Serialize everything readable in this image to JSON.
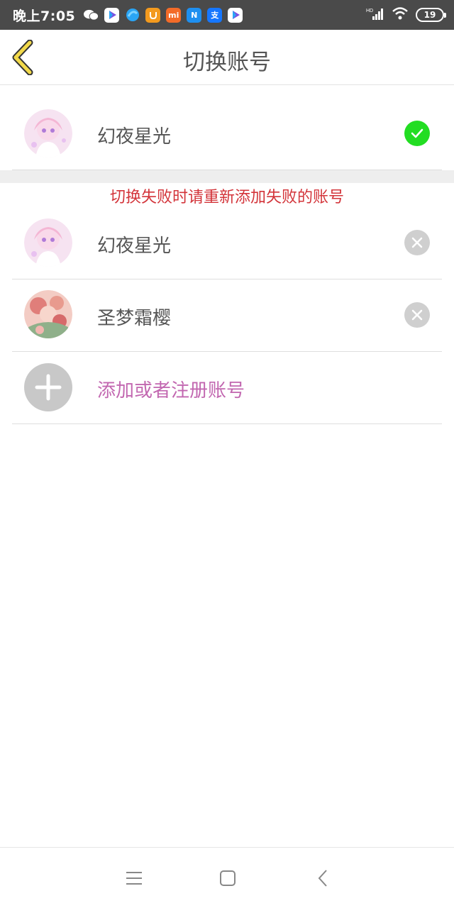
{
  "status_bar": {
    "time": "晚上7:05",
    "notification_icons": [
      "wechat-icon",
      "play-store-icon",
      "blue-app-icon",
      "orange-app-icon",
      "mi-icon",
      "n-app-icon",
      "alipay-icon",
      "play-store-icon"
    ],
    "mi_text": "mi",
    "n_text": "N",
    "alipay_text": "支",
    "battery": "19"
  },
  "header": {
    "title": "切换账号"
  },
  "current_account": {
    "name": "幻夜星光",
    "status": "check-icon"
  },
  "warning": "切换失败时请重新添加失败的账号",
  "accounts": [
    {
      "name": "幻夜星光",
      "action": "remove-icon"
    },
    {
      "name": "圣梦霜樱",
      "action": "remove-icon"
    }
  ],
  "add_account": {
    "label": "添加或者注册账号"
  },
  "colors": {
    "check_green": "#22dd22",
    "warning_red": "#d3343a",
    "add_purple": "#c267b0",
    "back_arrow": "#f2d94a"
  }
}
